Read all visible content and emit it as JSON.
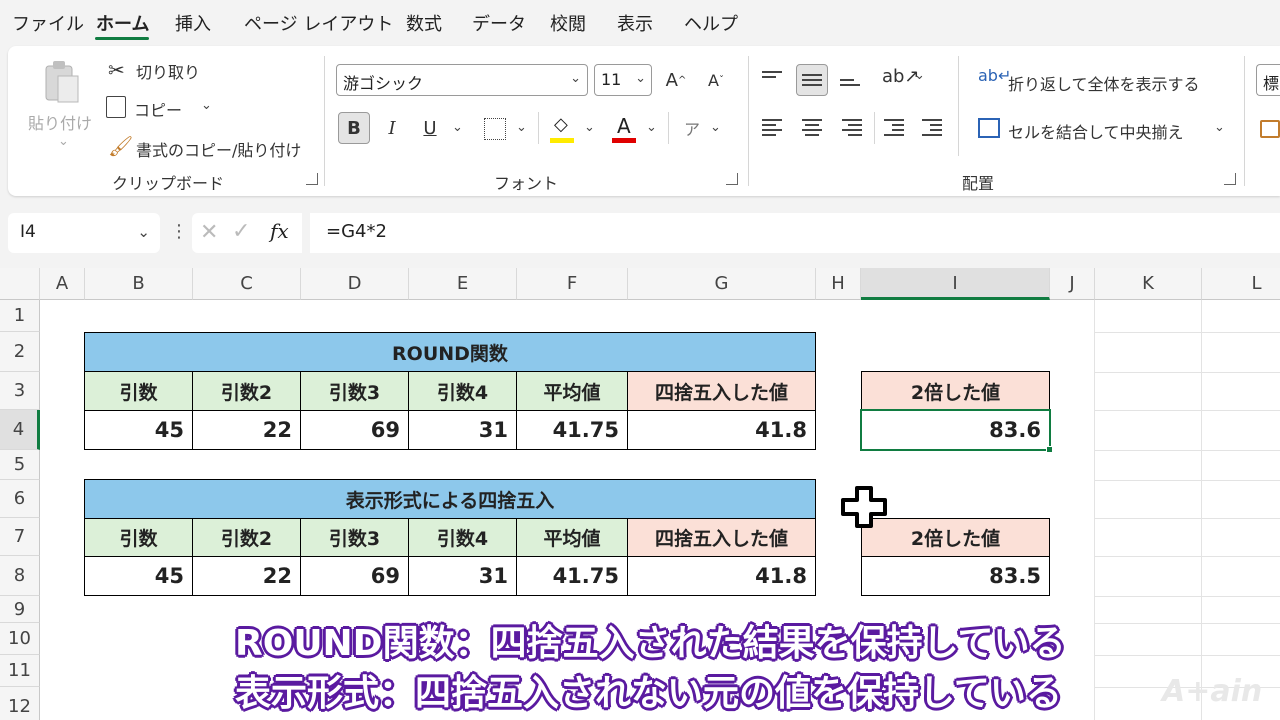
{
  "menu": {
    "items": [
      "ファイル",
      "ホーム",
      "挿入",
      "ページ レイアウト",
      "数式",
      "データ",
      "校閲",
      "表示",
      "ヘルプ"
    ]
  },
  "ribbon": {
    "clipboard": {
      "paste": "貼り付け",
      "cut": "切り取り",
      "copy": "コピー",
      "format_painter": "書式のコピー/貼り付け",
      "group": "クリップボード"
    },
    "font": {
      "font_name": "游ゴシック",
      "font_size": "11",
      "bold": "B",
      "italic": "I",
      "underline": "U",
      "furigana": "ア",
      "group": "フォント"
    },
    "alignment": {
      "wrap_text": "折り返して全体を表示する",
      "merge_center": "セルを結合して中央揃え",
      "group": "配置"
    },
    "number_format_partial": "標"
  },
  "formula_bar": {
    "name_box": "I4",
    "fx": "fx",
    "formula": "=G4*2"
  },
  "grid": {
    "columns": [
      "A",
      "B",
      "C",
      "D",
      "E",
      "F",
      "G",
      "H",
      "I",
      "J",
      "K",
      "L"
    ],
    "rows": [
      "1",
      "2",
      "3",
      "4",
      "5",
      "6",
      "7",
      "8",
      "9",
      "10",
      "11",
      "12"
    ]
  },
  "table1": {
    "title": "ROUND関数",
    "headers": [
      "引数",
      "引数2",
      "引数3",
      "引数4",
      "平均値",
      "四捨五入した値"
    ],
    "values": [
      "45",
      "22",
      "69",
      "31",
      "41.75",
      "41.8"
    ],
    "side_header": "2倍した値",
    "side_value": "83.6"
  },
  "table2": {
    "title": "表示形式による四捨五入",
    "headers": [
      "引数",
      "引数2",
      "引数3",
      "引数4",
      "平均値",
      "四捨五入した値"
    ],
    "values": [
      "45",
      "22",
      "69",
      "31",
      "41.75",
      "41.8"
    ],
    "side_header": "2倍した値",
    "side_value": "83.5"
  },
  "captions": {
    "line1": "ROUND関数：四捨五入された結果を保持している",
    "line2": "表示形式：四捨五入されない元の値を保持している"
  },
  "logo": "A+ain",
  "colors": {
    "excel_green": "#107c41",
    "title_blue": "#8dc8eb",
    "header_green": "#dcf0d8",
    "header_pink": "#fbe0d7",
    "caption_outline": "#5a1aa0"
  }
}
